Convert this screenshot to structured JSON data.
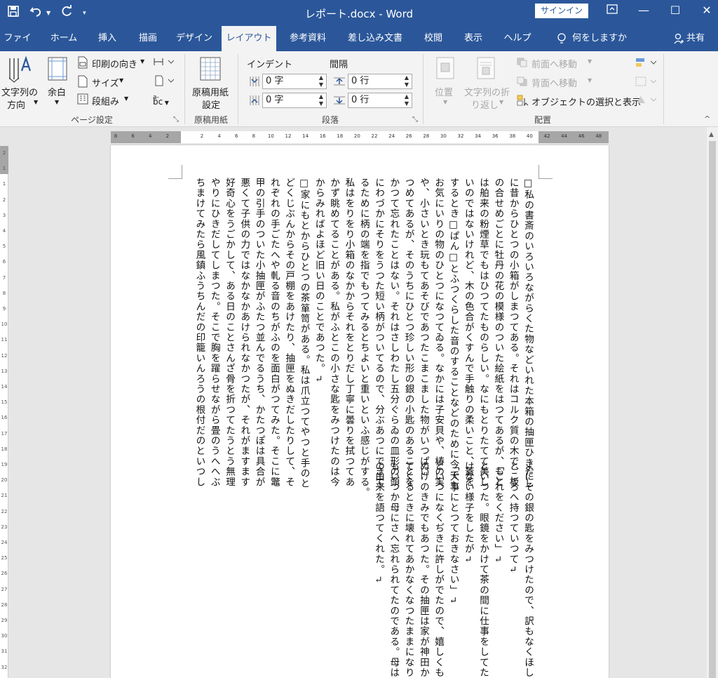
{
  "titlebar": {
    "title": "レポート.docx  -  Word",
    "signin": "サインイン",
    "qat_icons": [
      "save-icon",
      "undo-icon",
      "redo-icon",
      "customize-icon"
    ]
  },
  "tabs": [
    "ファイル",
    "ホーム",
    "挿入",
    "描画",
    "デザイン",
    "レイアウト",
    "参考資料",
    "差し込み文書",
    "校閲",
    "表示",
    "ヘルプ"
  ],
  "active_tab": "レイアウト",
  "tellme": "何をしますか",
  "share": "共有",
  "ribbon": {
    "page_setup": {
      "text_direction": [
        "文字列の",
        "方向"
      ],
      "margins": "余白",
      "orientation": "印刷の向き",
      "size": "サイズ",
      "columns": "段組み",
      "hyphen": "bc",
      "label": "ページ設定"
    },
    "genko": {
      "button": [
        "原稿用紙",
        "設定"
      ],
      "label": "原稿用紙"
    },
    "paragraph": {
      "indent_label": "インデント",
      "spacing_label": "間隔",
      "indent_before": "0 字",
      "indent_after": "0 字",
      "space_before": "0 行",
      "space_after": "0 行",
      "label": "段落"
    },
    "arrange": {
      "position": "位置",
      "wrap": [
        "文字列の折",
        "り返し"
      ],
      "bring_forward": "前面へ移動",
      "send_backward": "背面へ移動",
      "selection_pane": "オブジェクトの選択と表示",
      "label": "配置"
    }
  },
  "ruler": {
    "horizontal": [
      "8",
      "6",
      "4",
      "2",
      "",
      "2",
      "4",
      "6",
      "8",
      "10",
      "12",
      "14",
      "16",
      "18",
      "20",
      "22",
      "24",
      "26",
      "28",
      "30",
      "32",
      "34",
      "36",
      "38",
      "40",
      "42",
      "44",
      "46",
      "48"
    ],
    "vertical": [
      "2",
      "1",
      "1",
      "2",
      "3",
      "4",
      "5",
      "6",
      "7",
      "8",
      "9",
      "10",
      "11",
      "12",
      "13",
      "14",
      "15",
      "16",
      "17",
      "18",
      "19",
      "20",
      "21",
      "22",
      "23",
      "24",
      "25",
      "26",
      "27",
      "28",
      "29",
      "30",
      "31",
      "32"
    ]
  },
  "document": {
    "upper": [
      "□私の書斎のいろいろながらくた物などいれた本箱の抽匣ひきだし",
      "に昔からひとつの小箱がしまつてある。それはコルク質の木で、板",
      "の合せめごとに牡丹の花の模様のついた絵紙をはつてあるが、もと",
      "は舶来の粉煙草でもはひつてたものらしい。なにもとりたてて美し",
      "いのではないけれど、木の色合がくすんで手触りの柔いこと、蓋を",
      "するとき□ぱん□とふつくらした音のすることなどのために今でも",
      "お気にいりの物のひとつになつてゐる。なかには子安貝や、椿の実",
      "や、小さいとき玩もてあそびであつたこまこました物がいつぱい",
      "つめてあるが、そのうちにひとつ珍しい形の銀の小匙のあることを",
      "かつて忘れたことはない。それはさしわたし五分ぐらゐの皿形の頭",
      "にわづかにそりをうつた短い柄がついてるので、分ぶあつにできて",
      "るために柄の端を指でもつてみるとちよいと重いといふ感じがする。",
      "私はをりをり小箱のなかからそれをとりだし丁寧に曇りを拭つてあ",
      "かず眺めてることがある。私がふとこの小さな匙をみつけたのは今",
      "からみればよほど旧い日のことであつた。↵",
      "□家にもとからひとつの茶箪笥がある。私は爪立つてやつと手のと",
      "どくじぶんからその戸棚をあけたり、抽匣をぬきだしたりして、そ",
      "れぞれの手ごたへや軋る音のちがふのを面白がつてみた。そこに鼈",
      "甲の引手のついた小抽匣がふたつ並んでるうち、かたつぽは具合が",
      "悪くて子供の力ではなかなかあけられなかつたが、それがますます",
      "好奇心をうごかして、ある日のことさんざ骨を折つてたうとう無理",
      "やりにひきだしてしまつた。そこで胸を躍らせながら畳のうへへぶ",
      "ちまけてみたら風鎮ふうちんだの印籠いんろうの根付だのといつし"
    ],
    "lower": [
      "よにその銀の匙をみつけたので、訳もなくほしくなり",
      "ところへ持つていつて↵",
      "「これをください」↵",
      "といつた。眼鏡をかけて茶の間に仕事をしてた母はち",
      "けない様子をしたが↵",
      "「大事にとつておきなさい」↵",
      "といつになくぢきに許しがでたので、嬉しくもあり、",
      "ぬけのきみでもあつた。その抽匣は家が神田からこの",
      "てくるときに壊れてあかなくなつたままになり、由緒",
      "もいつか母にさへ忘れられてたのである。母は針をは",
      "の由来を語つてくれた。↵"
    ]
  }
}
